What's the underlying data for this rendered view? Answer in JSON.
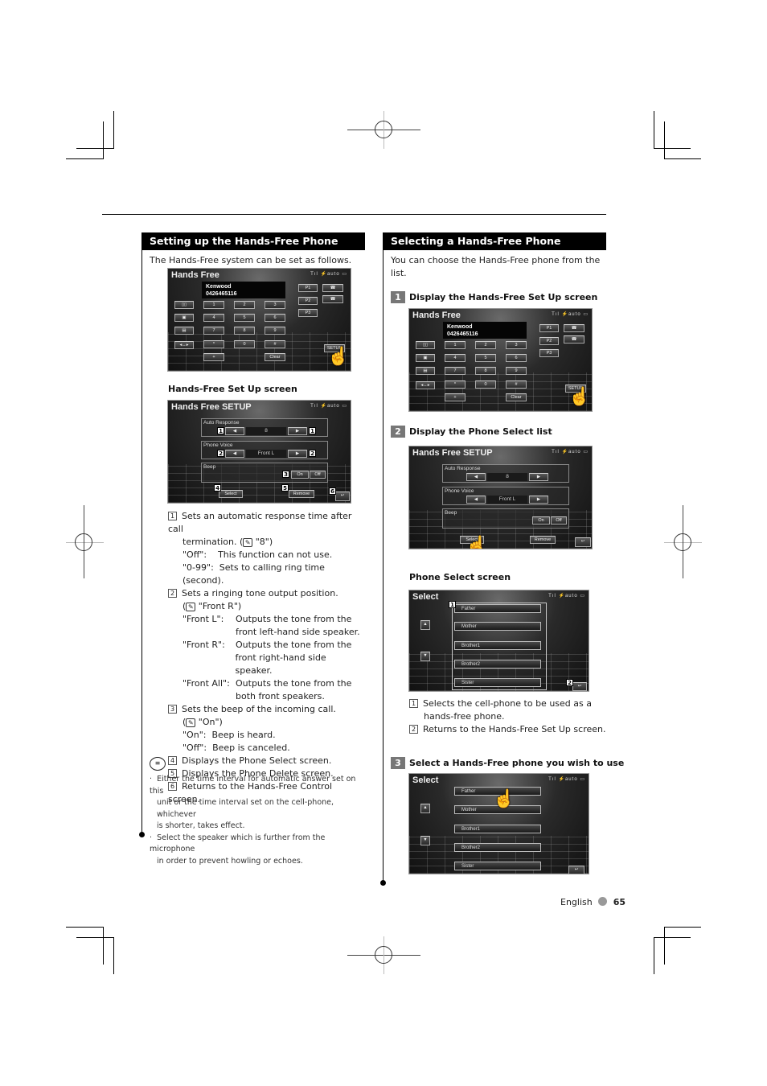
{
  "left": {
    "heading": "Setting up the Hands-Free Phone",
    "intro": "The Hands-Free system can be set as follows.",
    "setup_caption": "Hands-Free Set Up screen",
    "descriptions": [
      {
        "num": "1",
        "text": "Sets an automatic response time after call",
        "cont": "termination. (",
        "default": "\"8\")",
        "options": [
          {
            "key": "\"Off\":",
            "val": "This function can not use."
          },
          {
            "key": "\"0-99\":",
            "val": "Sets to calling ring time (second)."
          }
        ]
      },
      {
        "num": "2",
        "text": "Sets a ringing tone output position.",
        "default": "\"Front R\")",
        "options": [
          {
            "key": "\"Front L\":",
            "val1": "Outputs the tone from the",
            "val2": "front left-hand side speaker."
          },
          {
            "key": "\"Front R\":",
            "val1": "Outputs the tone from the",
            "val2": "front right-hand side speaker."
          },
          {
            "key": "\"Front All\":",
            "val1": "Outputs the tone from the",
            "val2": "both front speakers."
          }
        ]
      },
      {
        "num": "3",
        "text": "Sets the beep of the incoming call.",
        "default": "\"On\")",
        "options": [
          {
            "key": "\"On\":",
            "val": "Beep is heard."
          },
          {
            "key": "\"Off\":",
            "val": "Beep is canceled."
          }
        ]
      },
      {
        "num": "4",
        "text": "Displays the Phone Select screen."
      },
      {
        "num": "5",
        "text": "Displays the Phone Delete screen."
      },
      {
        "num": "6",
        "text": "Returns to the Hands-Free Control screen."
      }
    ],
    "notes": [
      [
        "Either the time interval for automatic answer set on this",
        "unit or the time interval set on the cell-phone, whichever",
        "is shorter, takes effect."
      ],
      [
        "Select the speaker which is further from the microphone",
        "in order to prevent howling or echoes."
      ]
    ]
  },
  "right": {
    "heading": "Selecting a Hands-Free Phone",
    "intro_l1": "You can choose the Hands-Free phone from the",
    "intro_l2": "list.",
    "steps": [
      {
        "num": "1",
        "label": "Display the Hands-Free Set Up screen"
      },
      {
        "num": "2",
        "label": "Display the Phone Select list"
      },
      {
        "num": "3",
        "label": "Select a Hands-Free phone you wish to use"
      }
    ],
    "phone_select_caption": "Phone Select screen",
    "descriptions": [
      {
        "num": "1",
        "l1": "Selects the cell-phone to be used as a",
        "l2": "hands-free phone."
      },
      {
        "num": "2",
        "l1": "Returns to the Hands-Free Set Up screen."
      }
    ]
  },
  "screens": {
    "hands_free": {
      "title": "Hands Free",
      "status": "Tıl  ⚡auto  ▭",
      "contact_name": "Kenwood",
      "contact_number": "0426465116",
      "keys": [
        "1",
        "2",
        "3",
        "4",
        "5",
        "6",
        "7",
        "8",
        "9",
        "*",
        "0",
        "#",
        "+",
        "Clear"
      ],
      "presets": [
        "P1",
        "P2",
        "P3"
      ],
      "setup_label": "SETUP"
    },
    "setup": {
      "title": "Hands Free SETUP",
      "status": "Tıl  ⚡auto  ▭",
      "auto_response_label": "Auto Response",
      "auto_response_value": "8",
      "phone_voice_label": "Phone Voice",
      "phone_voice_value": "Front L",
      "beep_label": "Beep",
      "beep_on": "On",
      "beep_off": "Off",
      "select_label": "Select",
      "remove_label": "Remove"
    },
    "select": {
      "title": "Select",
      "status": "Tıl  ⚡auto  ▭",
      "phones": [
        "Father",
        "Mother",
        "Brother1",
        "Brother2",
        "Sister"
      ]
    }
  },
  "footer": {
    "language": "English",
    "page": "65"
  }
}
